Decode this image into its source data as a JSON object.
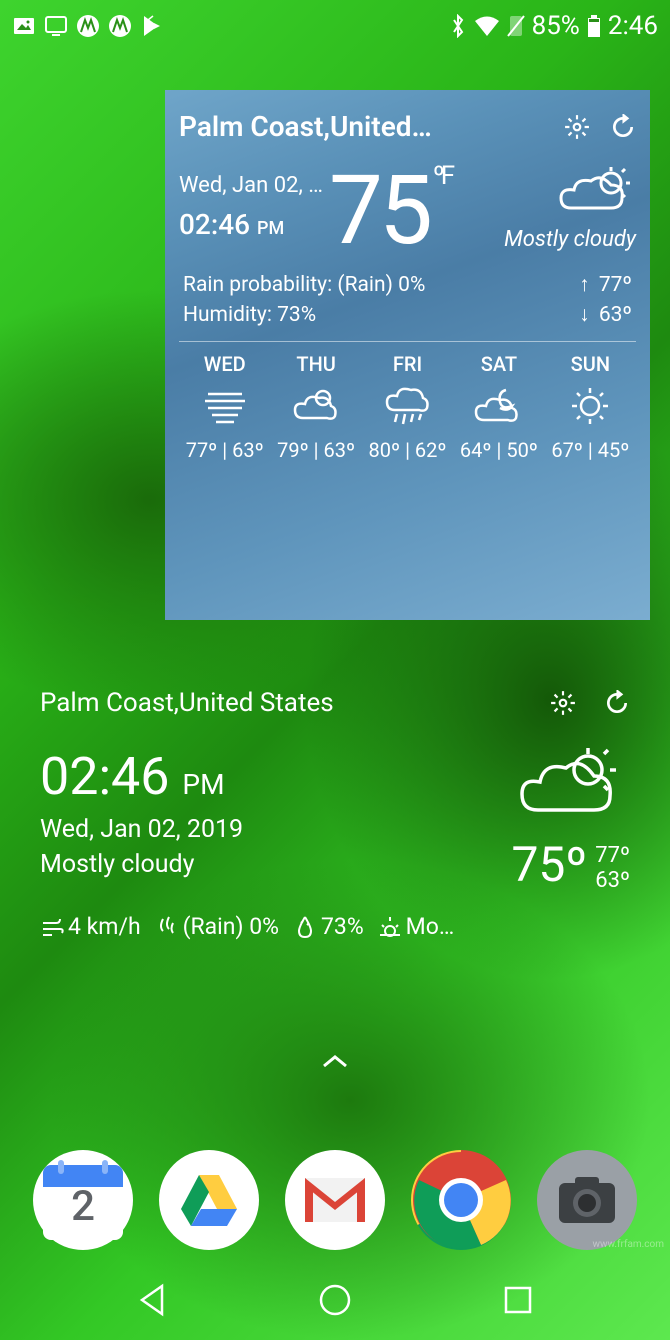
{
  "status": {
    "battery": "85%",
    "time": "2:46"
  },
  "widget1": {
    "location": "Palm Coast,United…",
    "date": "Wed, Jan 02, …",
    "time": "02:46",
    "ampm": "PM",
    "temp": "75",
    "unit": "ºF",
    "condition": "Mostly cloudy",
    "rain_label": "Rain probability: (Rain) 0%",
    "humidity_label": "Humidity: 73%",
    "high": "77º",
    "low": "63º",
    "forecast": [
      {
        "day": "WED",
        "icon": "fog",
        "hi": "77º",
        "lo": "63º"
      },
      {
        "day": "THU",
        "icon": "partly",
        "hi": "79º",
        "lo": "63º"
      },
      {
        "day": "FRI",
        "icon": "rain",
        "hi": "80º",
        "lo": "62º"
      },
      {
        "day": "SAT",
        "icon": "night",
        "hi": "64º",
        "lo": "50º"
      },
      {
        "day": "SUN",
        "icon": "sun",
        "hi": "67º",
        "lo": "45º"
      }
    ]
  },
  "widget2": {
    "location": "Palm Coast,United States",
    "time": "02:46",
    "ampm": "PM",
    "date": "Wed, Jan 02, 2019",
    "condition": "Mostly cloudy",
    "temp": "75º",
    "high": "77º",
    "low": "63º",
    "wind": "4 km/h",
    "rain": "(Rain) 0%",
    "humidity": "73%",
    "sun": "Mo…"
  },
  "dock": {
    "calendar_day": "2"
  },
  "watermark": "www.frfam.com"
}
